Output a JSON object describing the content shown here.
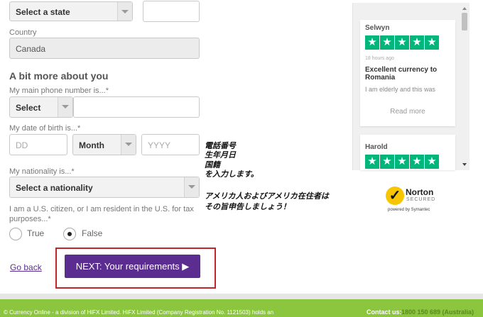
{
  "form": {
    "state_select": "Select a state",
    "country_label": "Country",
    "country_value": "Canada",
    "section_title": "A bit more about you",
    "phone_label": "My main phone number is...*",
    "phone_code_select": "Select",
    "dob_label": "My date of birth is...*",
    "dob_day_placeholder": "DD",
    "dob_month_select": "Month",
    "dob_year_placeholder": "YYYY",
    "nationality_label": "My nationality is...*",
    "nationality_select": "Select a nationality",
    "us_question_line1": "I am a U.S. citizen, or I am resident in the U.S. for tax",
    "us_question_line2": "purposes...*",
    "radio_true": "True",
    "radio_false": "False",
    "go_back": "Go back",
    "next_button": "NEXT: Your requirements ▶"
  },
  "annotation": {
    "line1": "電話番号",
    "line2": "生年月日",
    "line3": "国籍",
    "line4": "を入力します。",
    "line5": "アメリカ人およびアメリカ在住者は",
    "line6": "その旨申告しましょう！"
  },
  "reviews": [
    {
      "name": "Selwyn",
      "stars": 5,
      "time": "18 hours ago",
      "title": "Excellent currency to Romania",
      "snippet": "I am elderly and this was",
      "read_more": "Read more"
    },
    {
      "name": "Harold",
      "stars": 5
    }
  ],
  "norton": {
    "brand": "Norton",
    "secured": "SECURED",
    "powered": "powered by Symantec"
  },
  "footer": {
    "left": "© Currency Online - a division of HiFX Limited. HiFX Limited (Company Registration No. 1121503) holds an",
    "contact_label": "Contact us:",
    "contact_phone": "1800 150 689 (Australia)"
  },
  "colors": {
    "accent_purple": "#5b2d90",
    "highlight_red": "#c0272d",
    "trustpilot_green": "#00b67a",
    "footer_green": "#8cc63f"
  }
}
